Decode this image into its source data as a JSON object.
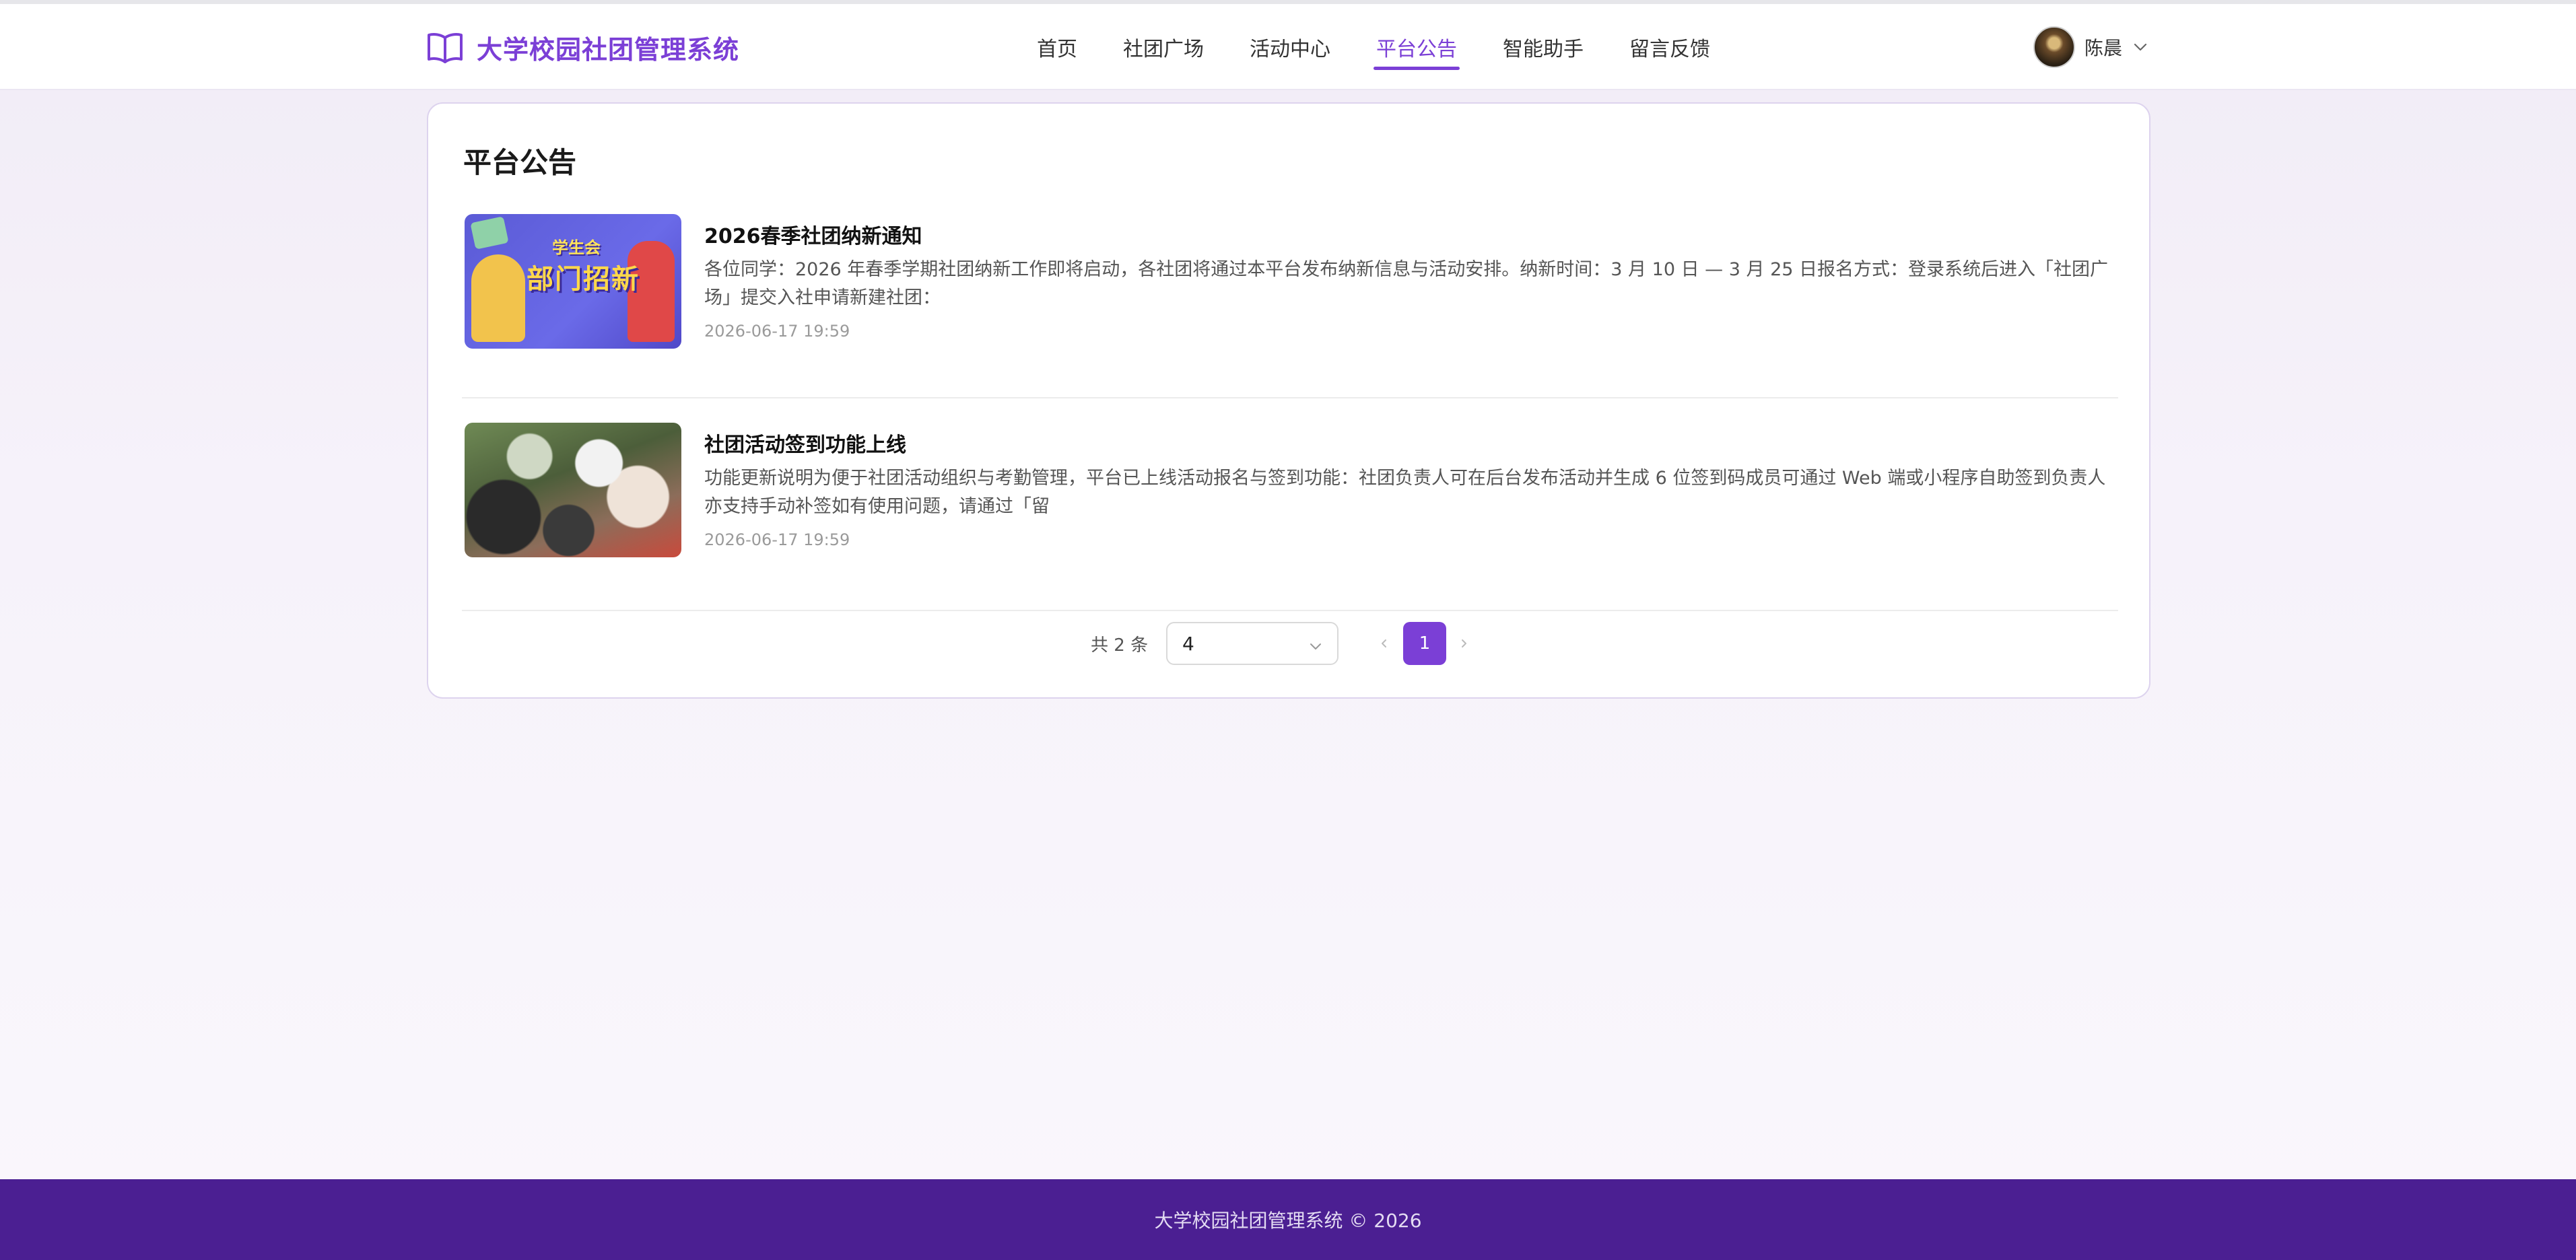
{
  "header": {
    "app_title": "大学校园社团管理系统",
    "nav": [
      {
        "label": "首页",
        "active": false
      },
      {
        "label": "社团广场",
        "active": false
      },
      {
        "label": "活动中心",
        "active": false
      },
      {
        "label": "平台公告",
        "active": true
      },
      {
        "label": "智能助手",
        "active": false
      },
      {
        "label": "留言反馈",
        "active": false
      }
    ],
    "user_name": "陈晨",
    "brand_color": "#7b3fd6"
  },
  "main": {
    "title": "平台公告",
    "announcements": [
      {
        "title": "2026春季社团纳新通知",
        "summary": "各位同学：2026 年春季学期社团纳新工作即将启动，各社团将通过本平台发布纳新信息与活动安排。纳新时间：3 月 10 日 — 3 月 25 日报名方式：登录系统后进入「社团广场」提交入社申请新建社团：",
        "date": "2026-06-17 19:59",
        "thumb_text_top": "学生会",
        "thumb_text_main": "部门招新"
      },
      {
        "title": "社团活动签到功能上线",
        "summary": "功能更新说明为便于社团活动组织与考勤管理，平台已上线活动报名与签到功能：社团负责人可在后台发布活动并生成 6 位签到码成员可通过 Web 端或小程序自助签到负责人亦支持手动补签如有使用问题，请通过「留",
        "date": "2026-06-17 19:59"
      }
    ],
    "pagination": {
      "total_text": "共 2 条",
      "page_size": "4",
      "current_page": "1"
    }
  },
  "footer": {
    "text": "大学校园社团管理系统 © 2026"
  }
}
